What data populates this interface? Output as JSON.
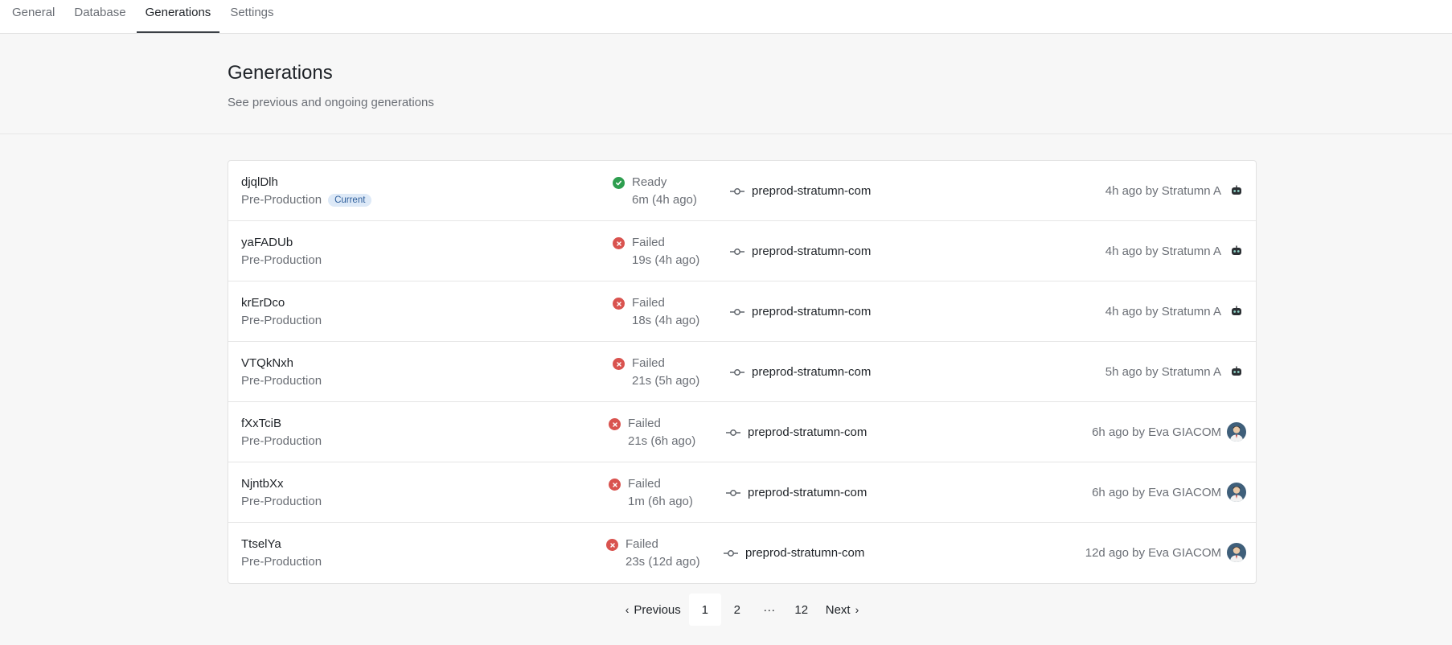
{
  "tabs": [
    {
      "label": "General"
    },
    {
      "label": "Database"
    },
    {
      "label": "Generations"
    },
    {
      "label": "Settings"
    }
  ],
  "active_tab": "Generations",
  "header": {
    "title": "Generations",
    "subtitle": "See previous and ongoing generations"
  },
  "rows": [
    {
      "id": "djqlDlh",
      "env": "Pre-Production",
      "badge": "Current",
      "status": "Ready",
      "duration": "6m (4h ago)",
      "branch": "preprod-stratumn-com",
      "meta": "4h ago by Stratumn A",
      "avatar": "robot-avatar-icon"
    },
    {
      "id": "yaFADUb",
      "env": "Pre-Production",
      "badge": "",
      "status": "Failed",
      "duration": "19s (4h ago)",
      "branch": "preprod-stratumn-com",
      "meta": "4h ago by Stratumn A",
      "avatar": "robot-avatar-icon"
    },
    {
      "id": "krErDco",
      "env": "Pre-Production",
      "badge": "",
      "status": "Failed",
      "duration": "18s (4h ago)",
      "branch": "preprod-stratumn-com",
      "meta": "4h ago by Stratumn A",
      "avatar": "robot-avatar-icon"
    },
    {
      "id": "VTQkNxh",
      "env": "Pre-Production",
      "badge": "",
      "status": "Failed",
      "duration": "21s (5h ago)",
      "branch": "preprod-stratumn-com",
      "meta": "5h ago by Stratumn A",
      "avatar": "robot-avatar-icon"
    },
    {
      "id": "fXxTciB",
      "env": "Pre-Production",
      "badge": "",
      "status": "Failed",
      "duration": "21s (6h ago)",
      "branch": "preprod-stratumn-com",
      "meta": "6h ago by Eva GIACOM",
      "avatar": "user-avatar-icon"
    },
    {
      "id": "NjntbXx",
      "env": "Pre-Production",
      "badge": "",
      "status": "Failed",
      "duration": "1m (6h ago)",
      "branch": "preprod-stratumn-com",
      "meta": "6h ago by Eva GIACOM",
      "avatar": "user-avatar-icon"
    },
    {
      "id": "TtselYa",
      "env": "Pre-Production",
      "badge": "",
      "status": "Failed",
      "duration": "23s (12d ago)",
      "branch": "preprod-stratumn-com",
      "meta": "12d ago by Eva GIACOM",
      "avatar": "user-avatar-icon"
    }
  ],
  "colors": {
    "ready": "#2e9e4f",
    "failed": "#d9534f",
    "badge_bg": "#dde9f7",
    "badge_text": "#2f5f9c"
  },
  "pagination": {
    "previous": "Previous",
    "next": "Next",
    "pages": [
      "1",
      "2",
      "12"
    ],
    "ellipsis": "···",
    "current": "1"
  }
}
